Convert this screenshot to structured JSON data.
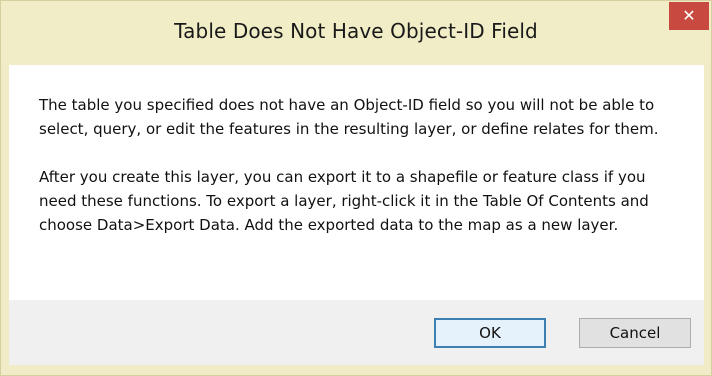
{
  "dialog": {
    "title": "Table Does Not Have Object-ID Field",
    "close_icon": "close-icon",
    "message": {
      "paragraph_1": "The table you specified does not have an Object-ID field so you will not be able to select, query, or edit the features in the resulting layer, or define relates for them.",
      "paragraph_2": "After you create this layer, you can export it to a shapefile or feature class if you need these functions. To export a layer, right-click it in the Table Of Contents and choose Data>Export Data. Add the exported data to the map as a new layer."
    },
    "buttons": {
      "ok_label": "OK",
      "cancel_label": "Cancel"
    },
    "colors": {
      "titlebar": "#f1edc6",
      "close_button": "#c7493f",
      "footer": "#f0f0f0",
      "default_button_border": "#3c7fb1"
    }
  }
}
